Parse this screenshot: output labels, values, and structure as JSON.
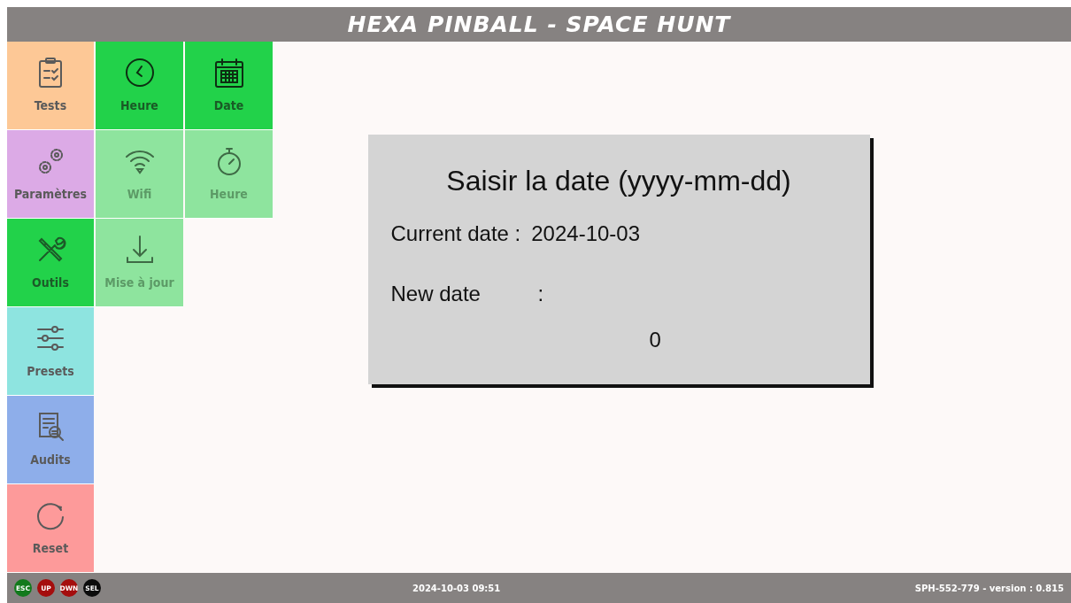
{
  "header": {
    "title": "HEXA PINBALL - SPACE HUNT"
  },
  "menu": [
    {
      "label": "Tests",
      "color": "#fdc896",
      "selected": false
    },
    {
      "label": "Paramètres",
      "color": "#dcaae6",
      "selected": false
    },
    {
      "label": "Outils",
      "color": "#22d24a",
      "selected": true
    },
    {
      "label": "Presets",
      "color": "#8ee4e0",
      "selected": false
    },
    {
      "label": "Audits",
      "color": "#8eaeea",
      "selected": false
    },
    {
      "label": "Reset",
      "color": "#fd9a9a",
      "selected": false
    }
  ],
  "submenu": [
    [
      {
        "label": "Heure",
        "selected": true
      },
      {
        "label": "Date",
        "selected": true
      }
    ],
    [
      {
        "label": "Wifi",
        "selected": false
      },
      {
        "label": "Heure",
        "selected": false
      }
    ],
    [
      {
        "label": "Mise à jour",
        "selected": false
      }
    ]
  ],
  "dialog": {
    "title": "Saisir la date (yyyy-mm-dd)",
    "current_label": "Current date :",
    "current_value": "2024-10-03",
    "new_label": "New date",
    "separator": ":",
    "entry": "0"
  },
  "status_bar": {
    "keys": [
      {
        "label": "ESC",
        "color": "#127a1c"
      },
      {
        "label": "UP",
        "color": "#a50d0d"
      },
      {
        "label": "DWN",
        "color": "#a50d0d"
      },
      {
        "label": "SEL",
        "color": "#0c0c0c"
      }
    ],
    "datetime": "2024-10-03 09:51",
    "version": "SPH-552-779 - version : 0.815"
  }
}
